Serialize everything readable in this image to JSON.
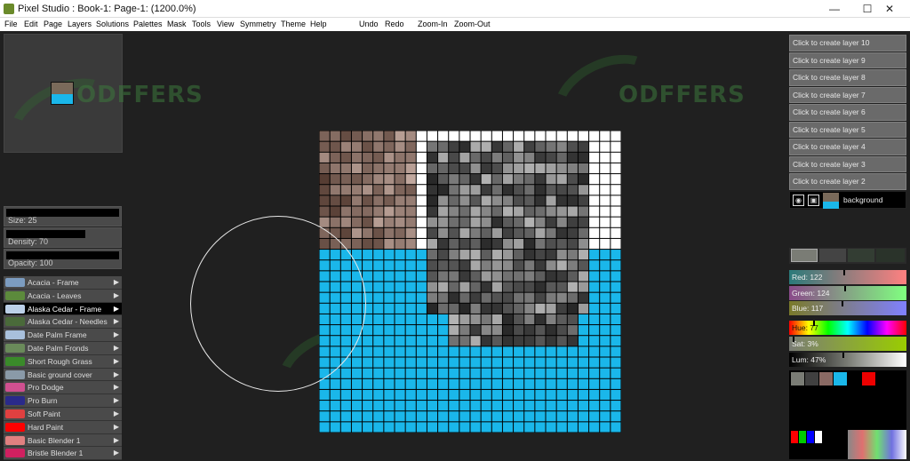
{
  "window": {
    "title": "Pixel Studio : Book-1: Page-1:  (1200.0%)",
    "minimize": "—",
    "maximize": "☐",
    "close": "✕"
  },
  "menu": [
    "File",
    "Edit",
    "Page",
    "Layers",
    "Solutions",
    "Palettes",
    "Mask",
    "Tools",
    "View",
    "Symmetry",
    "Theme",
    "Help",
    "Undo",
    "Redo",
    "Zoom-In",
    "Zoom-Out"
  ],
  "watermark": "ODFFERS",
  "brush_settings": {
    "size": "Size: 25",
    "density": "Density: 70",
    "opacity": "Opacity: 100",
    "size_level": 1.0,
    "density_level": 0.7,
    "opacity_level": 1.0
  },
  "brushes": [
    {
      "label": "Acacia - Frame",
      "color": "#7c9cc0"
    },
    {
      "label": "Acacia - Leaves",
      "color": "#5c8a3c"
    },
    {
      "label": "Alaska Cedar - Frame",
      "color": "#bcd0e8",
      "selected": true
    },
    {
      "label": "Alaska Cedar - Needles",
      "color": "#4a6a3a"
    },
    {
      "label": "Date Palm Frame",
      "color": "#a8c0dc"
    },
    {
      "label": "Date Palm Fronds",
      "color": "#6a8a5a"
    },
    {
      "label": "Short Rough Grass",
      "color": "#3a8a2a"
    },
    {
      "label": "Basic ground cover",
      "color": "#8a9aa8"
    },
    {
      "label": "Pro Dodge",
      "color": "#d05090"
    },
    {
      "label": "Pro Burn",
      "color": "#2a2a8a"
    },
    {
      "label": "Soft Paint",
      "color": "#e04040"
    },
    {
      "label": "Hard Paint",
      "color": "#ff0000"
    },
    {
      "label": "Basic Blender 1",
      "color": "#e08080"
    },
    {
      "label": "Bristle Blender 1",
      "color": "#d02060"
    }
  ],
  "layers": [
    "Click to create layer 10",
    "Click to create layer 9",
    "Click to create layer 8",
    "Click to create layer 7",
    "Click to create layer 6",
    "Click to create layer 5",
    "Click to create layer 4",
    "Click to create layer 3",
    "Click to create layer 2"
  ],
  "background_layer": {
    "label": "background",
    "eye_icon": "eye-icon",
    "lock_icon": "lock-icon"
  },
  "color": {
    "red": "Red: 122",
    "green": "Green: 124",
    "blue": "Blue: 117",
    "hue": "Hue: 77",
    "sat": "Sat: 3%",
    "lum": "Lum: 47%",
    "red_value": 122,
    "green_value": 124,
    "blue_value": 117,
    "hue_value": 77,
    "sat_value": 3,
    "lum_value": 47,
    "current": "#7a7c75"
  },
  "palette_swatches": [
    "#7a7c75",
    "#404040",
    "#8a6a64",
    "#1ab7ea",
    "#000000",
    "#ee0000"
  ],
  "canvas": {
    "grid_cells": 28,
    "water_color": "#1ab7ea",
    "sky_color": "#ffffff"
  }
}
